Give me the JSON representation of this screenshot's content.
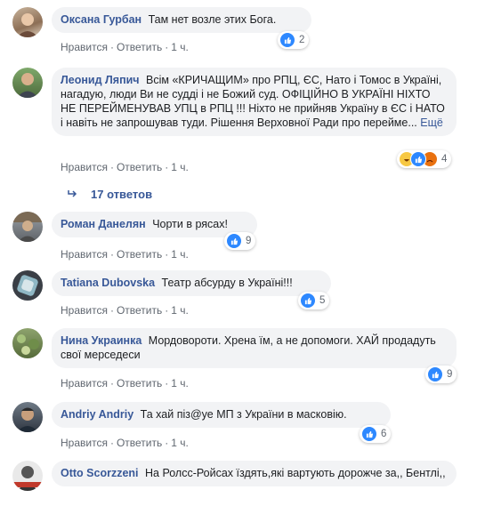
{
  "actions": {
    "like": "Нравится",
    "reply": "Ответить",
    "dot": "·"
  },
  "colors": {
    "link": "#385898",
    "bubble": "#f2f3f5",
    "like": "#2d88ff"
  },
  "comments": [
    {
      "author": "Оксана Гурбан",
      "text": "Там нет возле этих Бога.",
      "time": "1 ч.",
      "reactions": "2",
      "icons": [
        "like-icon"
      ]
    },
    {
      "author": "Леонид Ляпич",
      "text": "Всім «КРИЧАЩИМ» про РПЦ, ЄС, Нато і Томос в Україні, нагадую, люди Ви не судді і не Божий суд. ОФІЦІЙНО В УКРАЇНІ НІХТО НЕ ПЕРЕЙМЕНУВАВ УПЦ в РПЦ !!! Ніхто не прийняв Україну в ЄС і НАТО і навіть не запрошував туди. Рішення Верховної Ради про перейме...",
      "more": "Ещё",
      "time": "1 ч.",
      "reactions": "4",
      "icons": [
        "haha-icon",
        "like-icon",
        "angry-icon"
      ]
    },
    {
      "author": "Роман Данелян",
      "text": "Чорти в рясах!",
      "time": "1 ч.",
      "reactions": "9",
      "icons": [
        "like-icon"
      ]
    },
    {
      "author": "Tatiana Dubovska",
      "text": "Театр абсурду в Україні!!!",
      "time": "1 ч.",
      "reactions": "5",
      "icons": [
        "like-icon"
      ]
    },
    {
      "author": "Нина Украинка",
      "text": "Мордовороти. Хрена їм, а не допомоги. ХАЙ продадуть свої мерседеси",
      "time": "1 ч.",
      "reactions": "9",
      "icons": [
        "like-icon"
      ]
    },
    {
      "author": "Andriy Andriy",
      "text": "Та хай піз@уе МП з України в масковію.",
      "time": "1 ч.",
      "reactions": "6",
      "icons": [
        "like-icon"
      ]
    },
    {
      "author": "Otto Scorzzeni",
      "text": "На Ролсс-Ройсах їздять,які вартують дорожче за,, Бентлі,,",
      "time": "",
      "reactions": "",
      "icons": []
    }
  ],
  "replies_label": "17 ответов"
}
